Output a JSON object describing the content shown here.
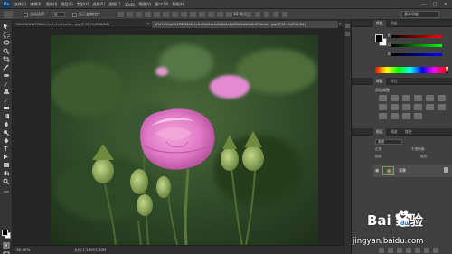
{
  "app": {
    "logo": "Ps",
    "menu": [
      "文件(F)",
      "编辑(E)",
      "图像(I)",
      "图层(L)",
      "类型(Y)",
      "选择(S)",
      "滤镜(T)",
      "3D(D)",
      "视图(V)",
      "窗口(W)",
      "帮助(H)"
    ],
    "window_controls": [
      "—",
      "□",
      "✕"
    ]
  },
  "options_bar": {
    "auto_select_label": "自动选择：",
    "auto_select_target": "组",
    "show_transform_label": "显示变换控件",
    "mode_3d_label": "3D 模式：",
    "workspace": "基本功能"
  },
  "tabs": [
    {
      "label": "20b1001f1c733b4b7ec7c41c5ea4ec...jpg @ 36.5%(RGB/8#)",
      "active": false
    },
    {
      "label": "d7a7d91ea912ff4542e8c1cfc40dd5ec4d5a6e4c4a6f5b0b6b5a8c6f2bc4d... jpg @ 36.5%(RGB/8#)",
      "active": true
    }
  ],
  "status": {
    "zoom": "36.46%",
    "doc": "文档:1.10M/1.10M"
  },
  "panels": {
    "top_tabs": [
      "颜色",
      "色板"
    ],
    "color_channels": [
      {
        "label": "R",
        "color": "#ff0000"
      },
      {
        "label": "G",
        "color": "#00ff00"
      },
      {
        "label": "B",
        "color": "#0000ff"
      }
    ],
    "adjust_tabs": [
      "调整",
      "样式"
    ],
    "adjust_title": "添加调整",
    "layer_tabs": [
      "图层",
      "通道",
      "路径"
    ],
    "layer_search": "类型",
    "layer_mode": "正常",
    "opacity_label": "不透明度:",
    "lock_label": "锁定:",
    "fill_label": "填充:",
    "layer_name": "背景"
  },
  "watermark": {
    "line1": "Bai  经验",
    "line2": "jingyan.baidu.com"
  },
  "colors": {
    "accent": "#3a7bd5",
    "flower_pink": "#e07ac6",
    "foliage": "#2e4a22"
  }
}
